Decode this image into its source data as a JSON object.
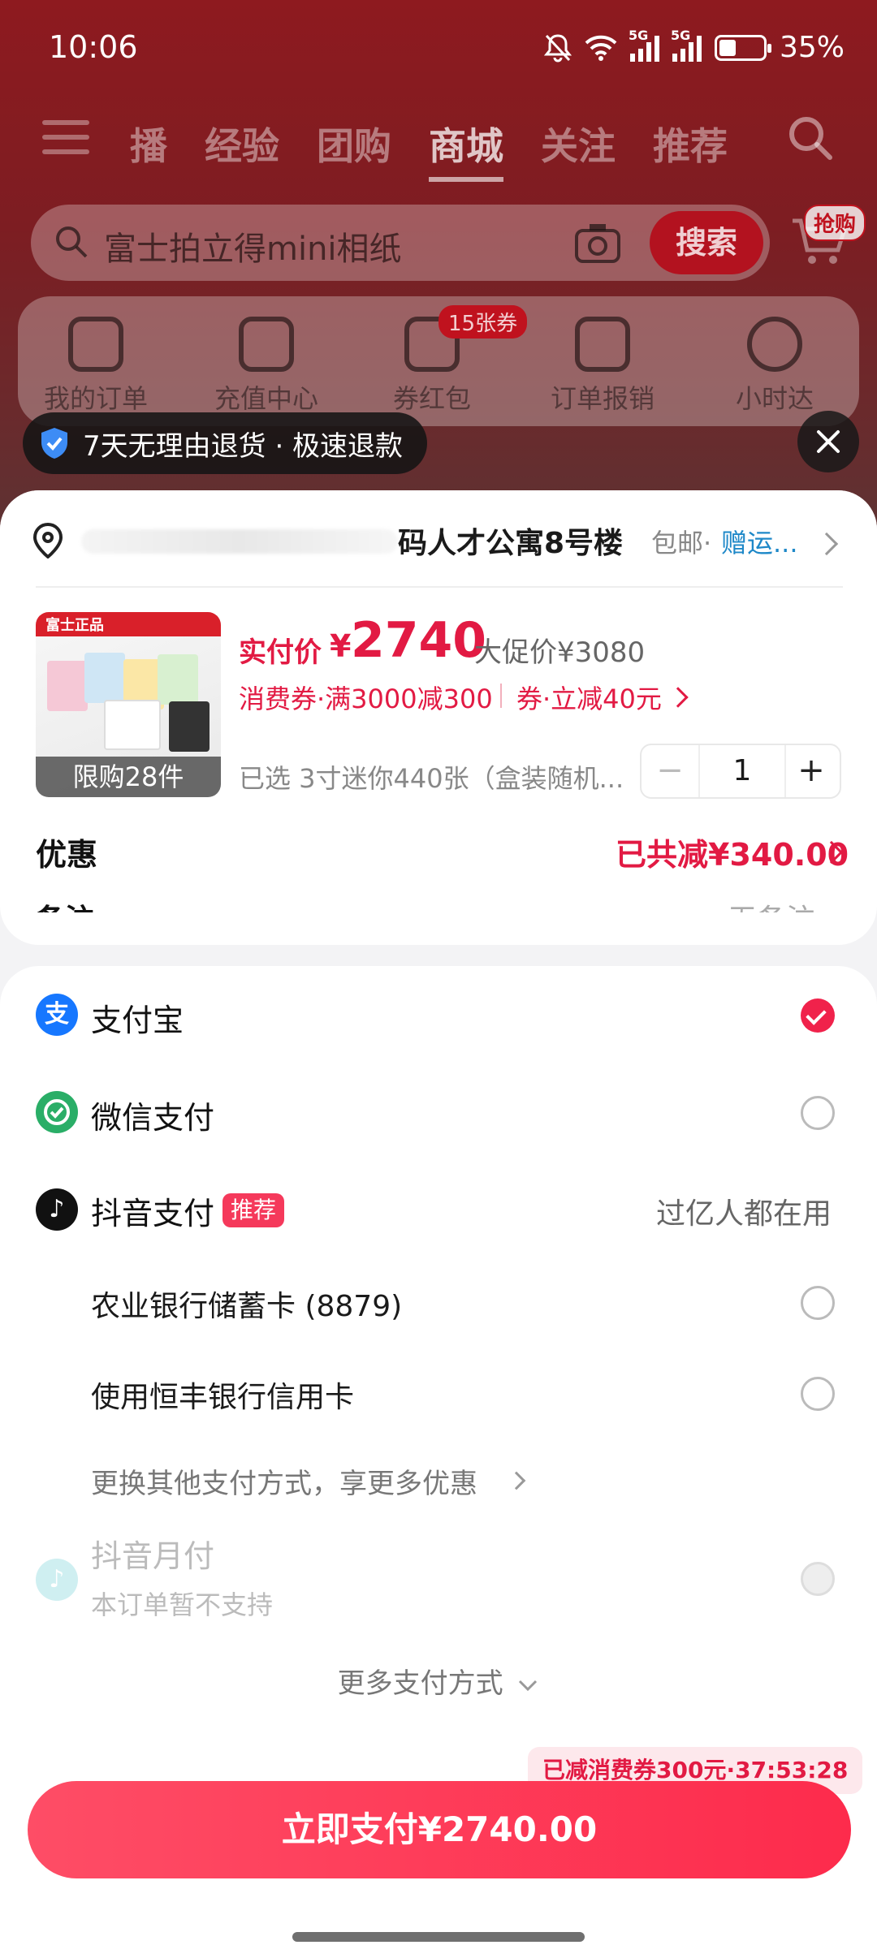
{
  "status": {
    "time": "10:06",
    "battery": "35%",
    "net1": "5G",
    "net2": "5G"
  },
  "nav": {
    "tabs": [
      "播",
      "经验",
      "团购",
      "商城",
      "关注",
      "推荐"
    ],
    "active": "商城"
  },
  "search": {
    "placeholder": "富士拍立得mini相纸",
    "button": "搜索",
    "cart_badge": "抢购"
  },
  "quick": {
    "items": [
      "我的订单",
      "充值中心",
      "券红包",
      "订单报销",
      "小时达"
    ],
    "badge": "15张券"
  },
  "toast": {
    "text": "7天无理由退货 · 极速退款"
  },
  "address": {
    "text": "码人才公寓8号楼",
    "shipping": "包邮",
    "dot": "·",
    "gift": "赠运..."
  },
  "product": {
    "image_top_text": "富士正品",
    "limit": "限购28件",
    "price_label": "实付价",
    "currency": "¥",
    "price": "2740",
    "promo_price": "大促价¥3080",
    "coupon_text": "消费券·满3000减300",
    "coupon2_text": "券·立减40元",
    "spec": "已选 3寸迷你440张（盒装随机...",
    "quantity": "1",
    "minus": "−",
    "plus": "+"
  },
  "discount": {
    "label": "优惠",
    "value": "已共减¥340.00",
    "next_label": "备注",
    "next_value": "无备注"
  },
  "payment": {
    "alipay": "支付宝",
    "wechat": "微信支付",
    "douyin": "抖音支付",
    "douyin_tag": "推荐",
    "douyin_side": "过亿人都在用",
    "bank1": "农业银行储蓄卡 (8879)",
    "bank2": "使用恒丰银行信用卡",
    "more_methods": "更换其他支付方式，享更多优惠",
    "monthly": "抖音月付",
    "monthly_sub": "本订单暂不支持",
    "more_pay": "更多支付方式"
  },
  "footer": {
    "promo_tip": "已减消费券300元·37:53:28",
    "pay_button": "立即支付¥2740.00"
  },
  "colors": {
    "accent": "#e21a43",
    "alipay": "#1677ff",
    "wechat": "#2aae67",
    "douyin": "#111111"
  }
}
